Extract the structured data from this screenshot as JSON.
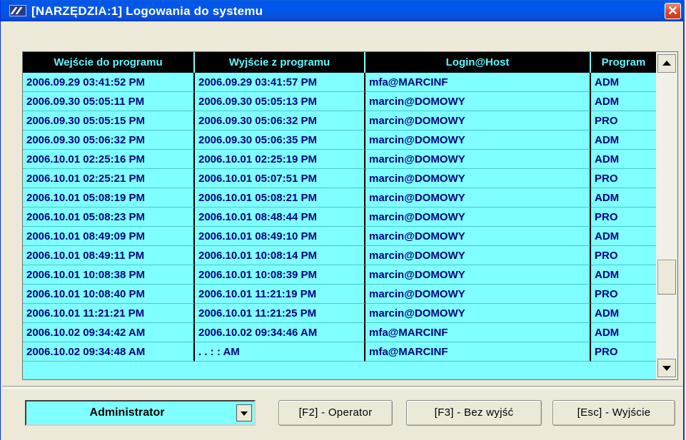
{
  "window": {
    "title": "[NARZĘDZIA:1]  Logowania do systemu",
    "close_symbol": "✕"
  },
  "table": {
    "columns": [
      "Wejście do programu",
      "Wyjście z programu",
      "Login@Host",
      "Program"
    ],
    "rows": [
      [
        "2006.09.29 03:41:52 PM",
        "2006.09.29 03:41:57 PM",
        "mfa@MARCINF",
        "ADM"
      ],
      [
        "2006.09.30 05:05:11 PM",
        "2006.09.30 05:05:13 PM",
        "marcin@DOMOWY",
        "ADM"
      ],
      [
        "2006.09.30 05:05:15 PM",
        "2006.09.30 05:06:32 PM",
        "marcin@DOMOWY",
        "PRO"
      ],
      [
        "2006.09.30 05:06:32 PM",
        "2006.09.30 05:06:35 PM",
        "marcin@DOMOWY",
        "ADM"
      ],
      [
        "2006.10.01 02:25:16 PM",
        "2006.10.01 02:25:19 PM",
        "marcin@DOMOWY",
        "ADM"
      ],
      [
        "2006.10.01 02:25:21 PM",
        "2006.10.01 05:07:51 PM",
        "marcin@DOMOWY",
        "PRO"
      ],
      [
        "2006.10.01 05:08:19 PM",
        "2006.10.01 05:08:21 PM",
        "marcin@DOMOWY",
        "ADM"
      ],
      [
        "2006.10.01 05:08:23 PM",
        "2006.10.01 08:48:44 PM",
        "marcin@DOMOWY",
        "PRO"
      ],
      [
        "2006.10.01 08:49:09 PM",
        "2006.10.01 08:49:10 PM",
        "marcin@DOMOWY",
        "ADM"
      ],
      [
        "2006.10.01 08:49:11 PM",
        "2006.10.01 10:08:14 PM",
        "marcin@DOMOWY",
        "PRO"
      ],
      [
        "2006.10.01 10:08:38 PM",
        "2006.10.01 10:08:39 PM",
        "marcin@DOMOWY",
        "ADM"
      ],
      [
        "2006.10.01 10:08:40 PM",
        "2006.10.01 11:21:19 PM",
        "marcin@DOMOWY",
        "PRO"
      ],
      [
        "2006.10.01 11:21:21 PM",
        "2006.10.01 11:21:25 PM",
        "marcin@DOMOWY",
        "ADM"
      ],
      [
        "2006.10.02 09:34:42 AM",
        "2006.10.02 09:34:46 AM",
        "mfa@MARCINF",
        "ADM"
      ],
      [
        "2006.10.02 09:34:48 AM",
        ". .   : :  AM",
        "mfa@MARCINF",
        "PRO"
      ]
    ]
  },
  "footer": {
    "role_select": "Administrator",
    "buttons": [
      "[F2] - Operator",
      "[F3] - Bez wyjść",
      "[Esc] - Wyjście"
    ]
  },
  "colors": {
    "grid_background": "#7fffff",
    "header_background": "#000000",
    "header_text": "#5ff7ff",
    "cell_text": "#000080",
    "titlebar": "#0058ee"
  },
  "icons": {
    "app": "app-logo-icon",
    "close": "close-icon",
    "scroll_up": "arrow-up-icon",
    "scroll_down": "arrow-down-icon",
    "dropdown": "chevron-down-icon"
  }
}
